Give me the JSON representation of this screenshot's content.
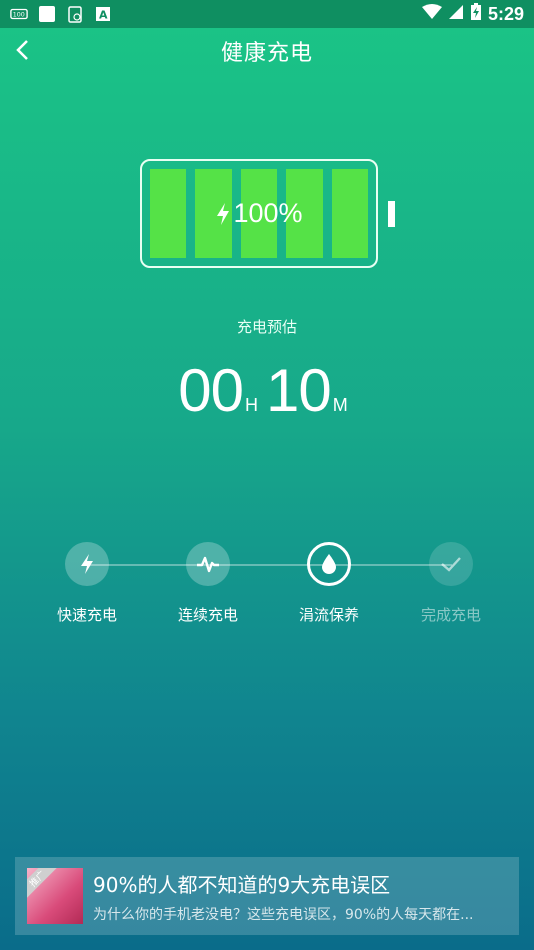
{
  "status_bar": {
    "time": "5:29",
    "left_icons": [
      "app-icon",
      "square-icon",
      "clipboard-icon",
      "text-icon"
    ],
    "right_icons": [
      "wifi-icon",
      "signal-icon",
      "battery-charging-icon"
    ]
  },
  "header": {
    "title": "健康充电",
    "back_icon": "back-arrow-icon"
  },
  "battery": {
    "percent_label": "100%",
    "cells": 5,
    "charging_icon": "lightning-icon"
  },
  "estimate": {
    "label": "充电预估",
    "hours": "00",
    "hours_unit": "H",
    "minutes": "10",
    "minutes_unit": "M"
  },
  "steps": [
    {
      "label": "快速充电",
      "icon": "lightning-icon",
      "state": "done"
    },
    {
      "label": "连续充电",
      "icon": "pulse-icon",
      "state": "done"
    },
    {
      "label": "涓流保养",
      "icon": "droplet-icon",
      "state": "active"
    },
    {
      "label": "完成充电",
      "icon": "check-icon",
      "state": "pending"
    }
  ],
  "ad": {
    "tag": "推广",
    "title": "90%的人都不知道的9大充电误区",
    "subtitle": "为什么你的手机老没电？这些充电误区，90%的人每天都在..."
  },
  "colors": {
    "battery_cell": "#55e247",
    "status_bar": "#0f8f61"
  }
}
